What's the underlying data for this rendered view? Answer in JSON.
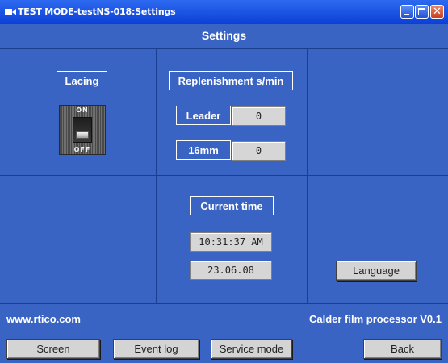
{
  "window": {
    "title": "TEST MODE-testNS-018:Settings",
    "icon": "app-video-icon"
  },
  "header": {
    "title": "Settings"
  },
  "lacing": {
    "label": "Lacing",
    "switch_on_text": "ON",
    "switch_off_text": "OFF",
    "state": "off"
  },
  "replenishment": {
    "title": "Replenishment s/min",
    "rows": [
      {
        "label": "Leader",
        "value": "0"
      },
      {
        "label": "16mm",
        "value": "0"
      }
    ]
  },
  "time": {
    "label": "Current time",
    "time_value": "10:31:37 AM",
    "date_value": "23.06.08"
  },
  "language_button": "Language",
  "footer": {
    "website": "www.rtico.com",
    "version": "Calder film processor V0.1"
  },
  "nav": {
    "screen": "Screen",
    "event_log": "Event log",
    "service_mode": "Service mode",
    "back": "Back"
  },
  "colors": {
    "background": "#3A64C3",
    "titlebar": "#0A3FD6",
    "grid_line": "#1C3E8E",
    "button_face": "#D4D4D4"
  }
}
